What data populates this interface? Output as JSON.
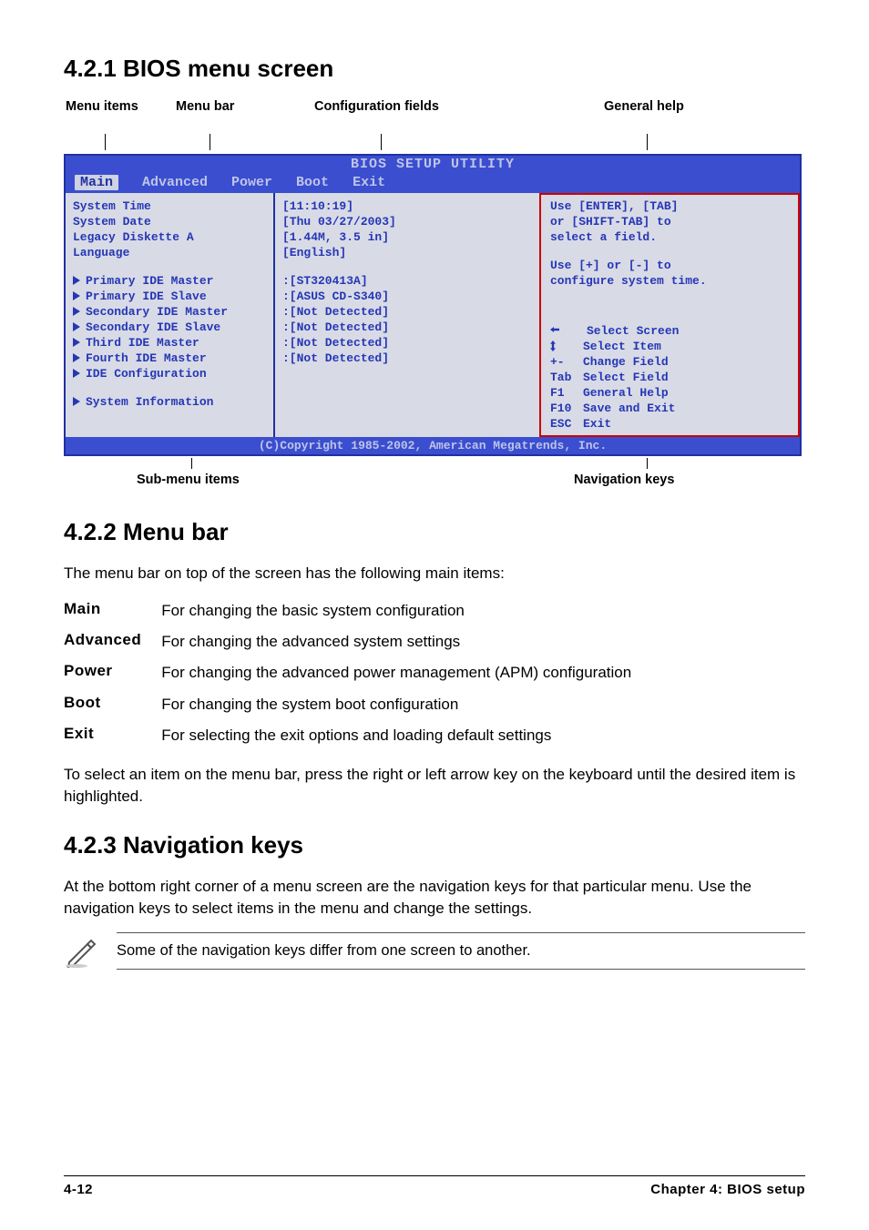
{
  "section1": {
    "heading": "4.2.1   BIOS menu screen"
  },
  "top_labels": {
    "menu_items": "Menu items",
    "menu_bar": "Menu bar",
    "config_fields": "Configuration fields",
    "general_help": "General help"
  },
  "bios": {
    "header_title": "BIOS SETUP UTILITY",
    "tabs": {
      "main": "Main",
      "advanced": "Advanced",
      "power": "Power",
      "boot": "Boot",
      "exit": "Exit"
    },
    "left_top": {
      "system_time": "System Time",
      "system_date": "System Date",
      "legacy_diskette": "Legacy Diskette A",
      "language": "Language"
    },
    "left_sub": {
      "pri_master": "Primary IDE Master",
      "pri_slave": "Primary IDE Slave",
      "sec_master": "Secondary IDE Master",
      "sec_slave": "Secondary IDE Slave",
      "third_master": "Third IDE Master",
      "fourth_master": "Fourth IDE Master",
      "ide_config": "IDE Configuration",
      "sys_info": "System Information"
    },
    "mid": {
      "time": "[11:10:19]",
      "date": "[Thu 03/27/2003]",
      "legacy": "[1.44M, 3.5 in]",
      "lang": "[English]",
      "pri_master": ":[ST320413A]",
      "pri_slave": ":[ASUS CD-S340]",
      "sec_master": ":[Not Detected]",
      "sec_slave": ":[Not Detected]",
      "third_master": ":[Not Detected]",
      "fourth_master": ":[Not Detected]"
    },
    "help": {
      "l1": "Use [ENTER], [TAB]",
      "l2": "or [SHIFT-TAB] to",
      "l3": "select a field.",
      "l4": "Use [+] or [-] to",
      "l5": "configure system time."
    },
    "nav": {
      "select_screen": "Select Screen",
      "select_item": "Select Item",
      "plusminus": "+-",
      "change_field": "Change Field",
      "tab": "Tab",
      "select_field": "Select Field",
      "f1": "F1",
      "general_help": "General Help",
      "f10": "F10",
      "save_exit": "Save and Exit",
      "esc": "ESC",
      "exit": "Exit"
    },
    "footer": "(C)Copyright 1985-2002, American Megatrends, Inc."
  },
  "under_labels": {
    "submenu": "Sub-menu items",
    "navkeys": "Navigation keys"
  },
  "section2": {
    "heading": "4.2.2   Menu bar",
    "intro": "The menu bar on top of the screen has the following main items:",
    "rows": {
      "main": {
        "term": "Main",
        "desc": "For changing the basic system configuration"
      },
      "advanced": {
        "term": "Advanced",
        "desc": "For changing the advanced system settings"
      },
      "power": {
        "term": "Power",
        "desc": "For changing the advanced power management (APM) configuration"
      },
      "boot": {
        "term": "Boot",
        "desc": "For changing the system boot configuration"
      },
      "exit": {
        "term": "Exit",
        "desc": "For selecting the exit options and loading default settings"
      }
    },
    "outro": "To select an item on the menu bar, press the right or left arrow key on the keyboard until the desired item is highlighted."
  },
  "section3": {
    "heading": "4.2.3   Navigation keys",
    "para": "At the bottom right corner of a menu screen are the navigation keys for that particular menu. Use the navigation keys to select items in the menu and change the settings.",
    "note": "Some of the navigation keys differ from one screen to another."
  },
  "footer": {
    "page": "4-12",
    "chapter": "Chapter 4: BIOS setup"
  }
}
